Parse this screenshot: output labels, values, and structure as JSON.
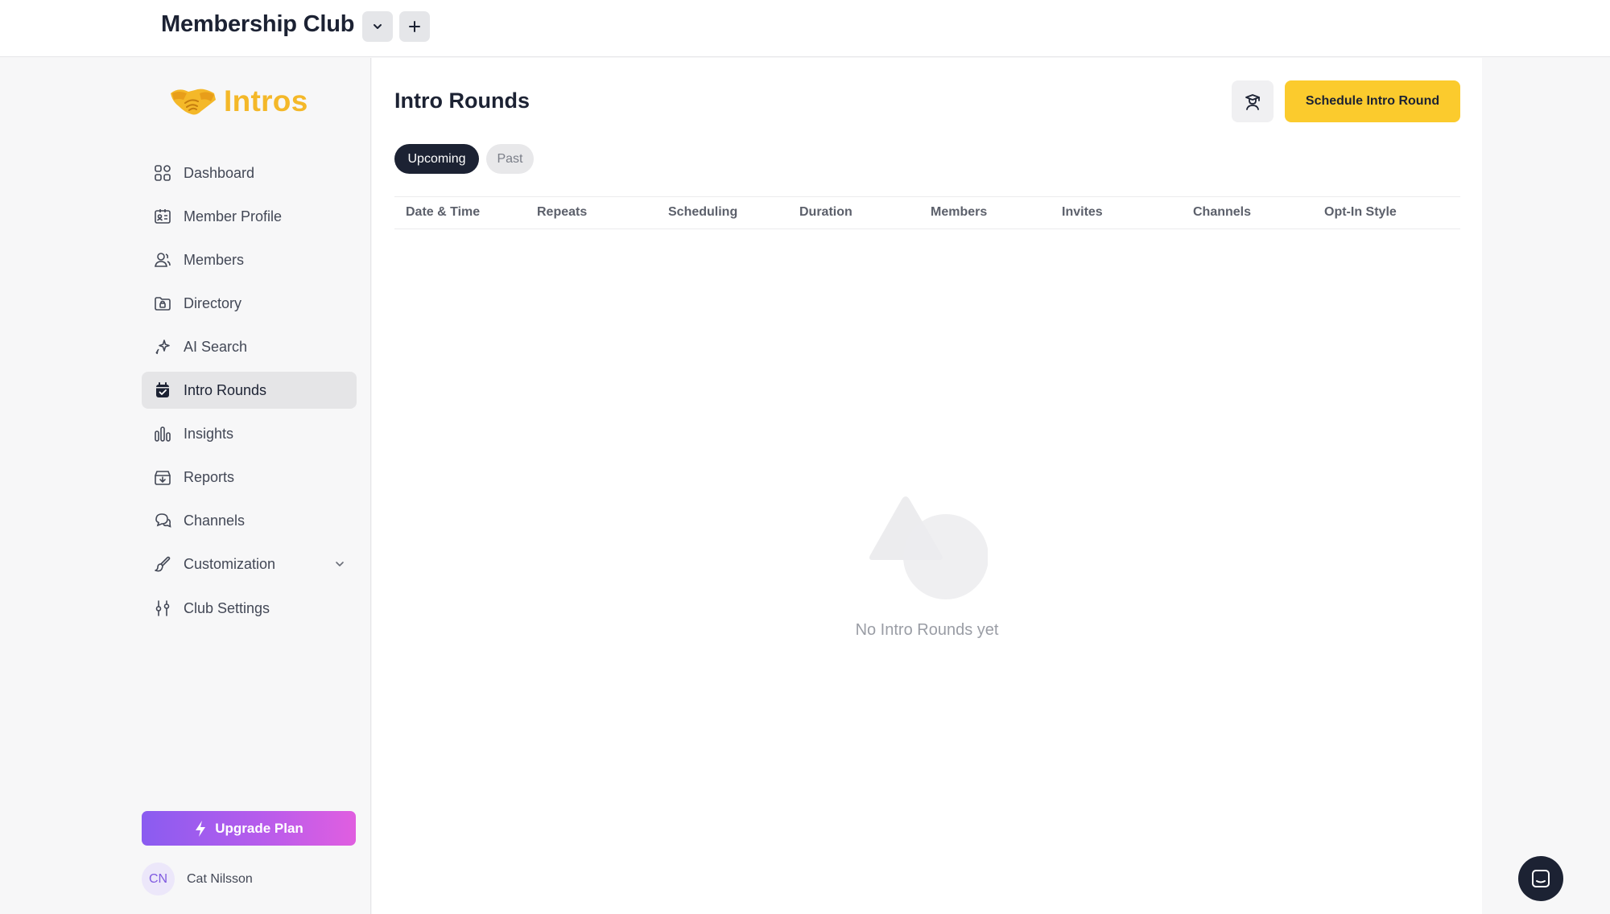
{
  "header": {
    "club_title": "Membership Club",
    "dropdown_icon": "chevron-down-icon",
    "add_icon": "plus-icon"
  },
  "brand": {
    "logo_icon": "handshake-icon",
    "name": "Intros",
    "color": "#f4b829"
  },
  "sidebar": {
    "items": [
      {
        "label": "Dashboard",
        "icon": "grid-icon",
        "active": false
      },
      {
        "label": "Member Profile",
        "icon": "id-card-icon",
        "active": false
      },
      {
        "label": "Members",
        "icon": "users-icon",
        "active": false
      },
      {
        "label": "Directory",
        "icon": "folder-lock-icon",
        "active": false
      },
      {
        "label": "AI Search",
        "icon": "sparkles-icon",
        "active": false
      },
      {
        "label": "Intro Rounds",
        "icon": "calendar-check-icon",
        "active": true
      },
      {
        "label": "Insights",
        "icon": "bar-chart-icon",
        "active": false
      },
      {
        "label": "Reports",
        "icon": "inbox-download-icon",
        "active": false
      },
      {
        "label": "Channels",
        "icon": "chat-bubbles-icon",
        "active": false
      },
      {
        "label": "Customization",
        "icon": "paint-brush-icon",
        "active": false,
        "expandable": true
      },
      {
        "label": "Club Settings",
        "icon": "sliders-icon",
        "active": false
      }
    ],
    "upgrade_label": "Upgrade Plan",
    "upgrade_icon": "lightning-icon",
    "user": {
      "initials": "CN",
      "name": "Cat Nilsson"
    }
  },
  "main": {
    "title": "Intro Rounds",
    "help_icon": "graduation-user-icon",
    "primary_action": "Schedule Intro Round",
    "accent": "#fbcb2d",
    "tabs": [
      {
        "label": "Upcoming",
        "selected": true
      },
      {
        "label": "Past",
        "selected": false
      }
    ],
    "columns": [
      "Date & Time",
      "Repeats",
      "Scheduling",
      "Duration",
      "Members",
      "Invites",
      "Channels",
      "Opt-In Style"
    ],
    "empty_state": {
      "icon": "shapes-icon",
      "message": "No Intro Rounds yet"
    }
  },
  "chat": {
    "icon": "chat-icon"
  }
}
